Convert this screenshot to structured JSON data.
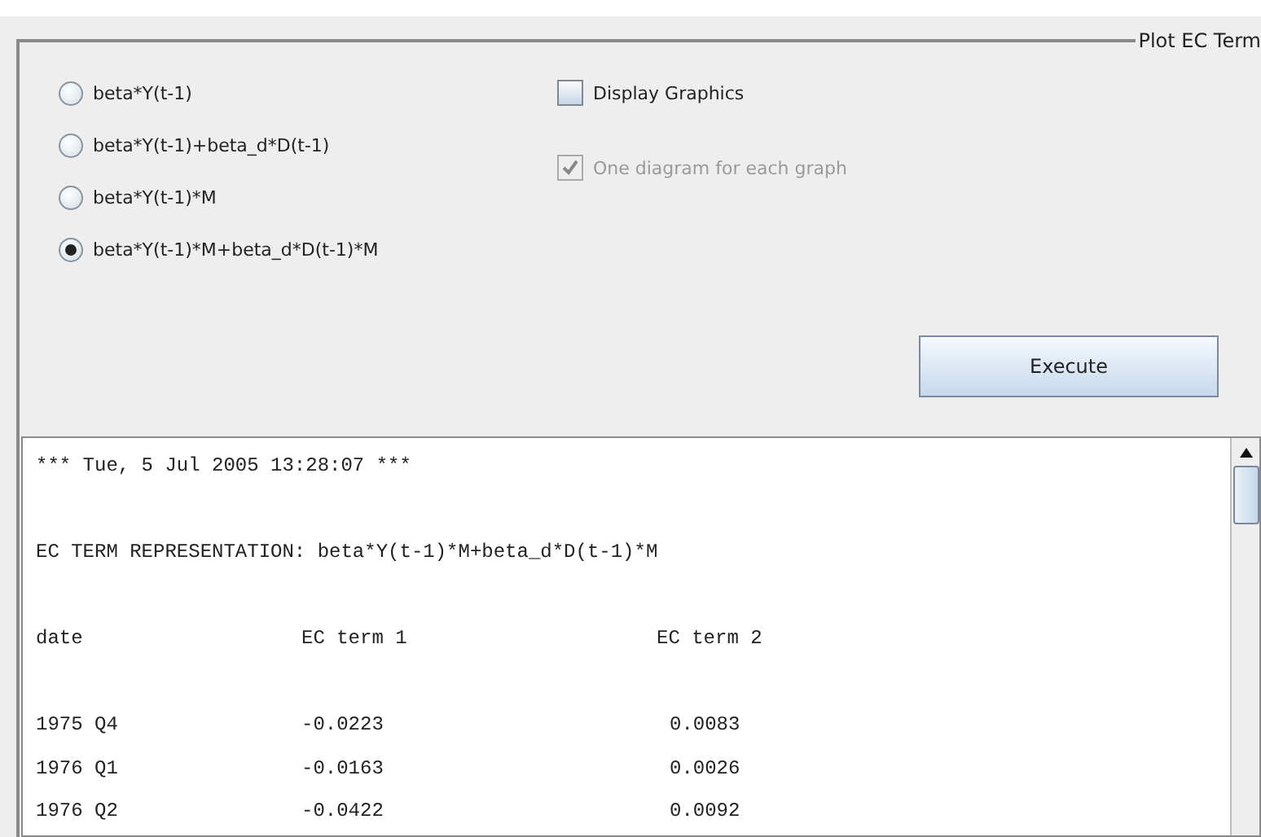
{
  "panel": {
    "title": "Plot EC Term"
  },
  "options": [
    {
      "label": "beta*Y(t-1)",
      "selected": false
    },
    {
      "label": "beta*Y(t-1)+beta_d*D(t-1)",
      "selected": false
    },
    {
      "label": "beta*Y(t-1)*M",
      "selected": false
    },
    {
      "label": "beta*Y(t-1)*M+beta_d*D(t-1)*M",
      "selected": true
    }
  ],
  "checkboxes": [
    {
      "label": "Display Graphics",
      "checked": false,
      "disabled": false
    },
    {
      "label": "One diagram for each graph",
      "checked": true,
      "disabled": true
    }
  ],
  "execute_button": "Execute",
  "output": {
    "timestamp_line": "*** Tue, 5 Jul 2005 13:28:07 ***",
    "representation_line": "EC TERM REPRESENTATION: beta*Y(t-1)*M+beta_d*D(t-1)*M",
    "columns": [
      "date",
      "EC term 1",
      "EC term 2"
    ],
    "rows": [
      [
        "1975 Q4",
        "-0.0223",
        "0.0083"
      ],
      [
        "1976 Q1",
        "-0.0163",
        "0.0026"
      ],
      [
        "1976 Q2",
        "-0.0422",
        "0.0092"
      ]
    ]
  }
}
